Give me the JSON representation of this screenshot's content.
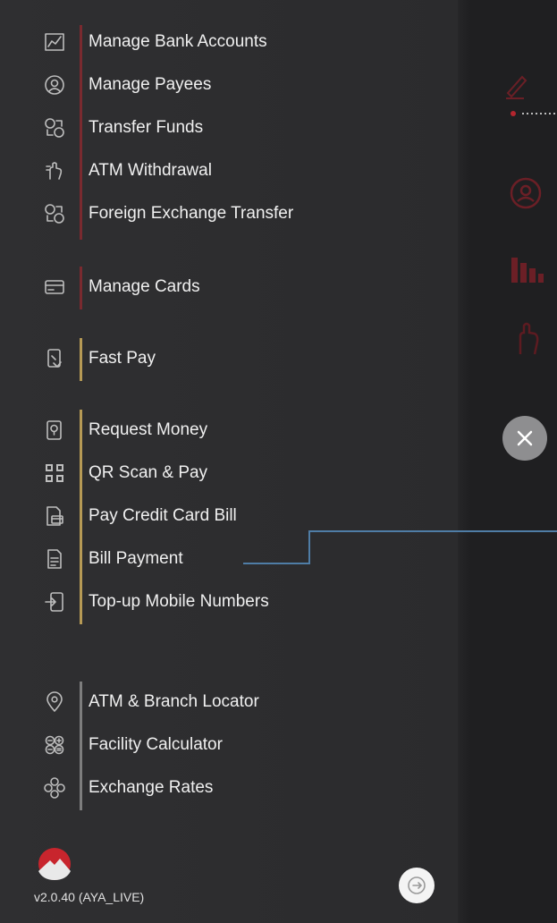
{
  "menu": {
    "groups": [
      {
        "accent": "#7a2a2f",
        "items": [
          {
            "label": "Manage Bank Accounts",
            "icon": "bank-chart-icon"
          },
          {
            "label": "Manage Payees",
            "icon": "payee-icon"
          },
          {
            "label": "Transfer Funds",
            "icon": "transfer-icon"
          },
          {
            "label": "ATM Withdrawal",
            "icon": "atm-hand-icon"
          },
          {
            "label": "Foreign Exchange Transfer",
            "icon": "fx-transfer-icon"
          }
        ]
      },
      {
        "accent": "#7a2a2f",
        "items": [
          {
            "label": "Manage Cards",
            "icon": "card-icon"
          }
        ]
      },
      {
        "accent": "#b69a55",
        "items": [
          {
            "label": "Fast Pay",
            "icon": "fast-pay-icon"
          }
        ]
      },
      {
        "accent": "#b69a55",
        "items": [
          {
            "label": "Request Money",
            "icon": "request-money-icon"
          },
          {
            "label": "QR Scan & Pay",
            "icon": "qr-icon"
          },
          {
            "label": "Pay Credit Card Bill",
            "icon": "credit-bill-icon"
          },
          {
            "label": "Bill Payment",
            "icon": "bill-icon"
          },
          {
            "label": "Top-up Mobile Numbers",
            "icon": "topup-icon"
          }
        ]
      },
      {
        "accent": "#7d7d7d",
        "items": [
          {
            "label": "ATM & Branch Locator",
            "icon": "location-pin-icon"
          },
          {
            "label": "Facility Calculator",
            "icon": "calculator-icon"
          },
          {
            "label": "Exchange Rates",
            "icon": "exchange-icon"
          }
        ]
      }
    ]
  },
  "footer": {
    "version": "v2.0.40 (AYA_LIVE)"
  },
  "colors": {
    "callout_line": "#4f7da6",
    "backdrop_icons": "#6b1f26"
  }
}
